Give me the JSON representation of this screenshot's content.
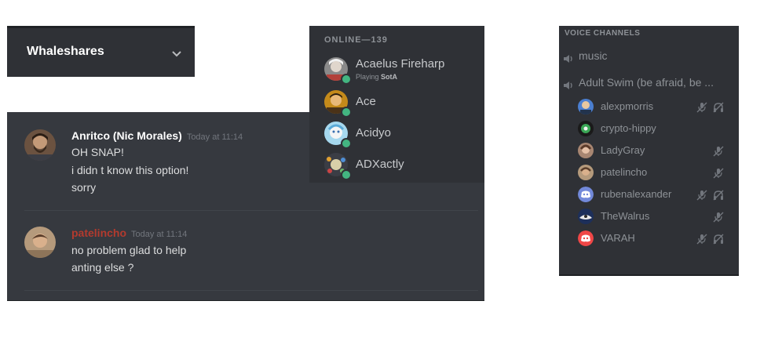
{
  "server": {
    "name": "Whaleshares"
  },
  "chat": {
    "messages": [
      {
        "author": "Anritco (Nic Morales)",
        "author_color": "#ffffff",
        "timestamp": "Today at 11:14",
        "lines": [
          "OH SNAP!",
          "i didn t know this option!",
          "sorry"
        ]
      },
      {
        "author": "patelincho",
        "author_color": "#b33a2e",
        "timestamp": "Today at 11:14",
        "lines": [
          "no problem glad to help",
          "anting else ?"
        ]
      }
    ]
  },
  "members": {
    "header": "ONLINE—139",
    "list": [
      {
        "name": "Acaelus Fireharp",
        "activity_prefix": "Playing ",
        "activity_game": "SotA",
        "status_color": "#43b581"
      },
      {
        "name": "Ace",
        "status_color": "#43b581"
      },
      {
        "name": "Acidyo",
        "status_color": "#43b581"
      },
      {
        "name": "ADXactly",
        "status_color": "#43b581"
      }
    ]
  },
  "voice": {
    "header": "VOICE CHANNELS",
    "channels": [
      {
        "name": "music",
        "icon": "speaker-icon"
      },
      {
        "name": "Adult Swim (be afraid, be ...",
        "icon": "speaker-icon"
      }
    ],
    "users": [
      {
        "name": "alexpmorris",
        "muted": true,
        "deafened": true
      },
      {
        "name": "crypto-hippy",
        "muted": false,
        "deafened": false
      },
      {
        "name": "LadyGray",
        "muted": true,
        "deafened": false
      },
      {
        "name": "patelincho",
        "muted": true,
        "deafened": false
      },
      {
        "name": "rubenalexander",
        "muted": true,
        "deafened": true
      },
      {
        "name": "TheWalrus",
        "muted": true,
        "deafened": false
      },
      {
        "name": "VARAH",
        "muted": true,
        "deafened": true
      }
    ]
  },
  "colors": {
    "online": "#43b581",
    "discord_blurple": "#7289da",
    "discord_red": "#f04747"
  }
}
